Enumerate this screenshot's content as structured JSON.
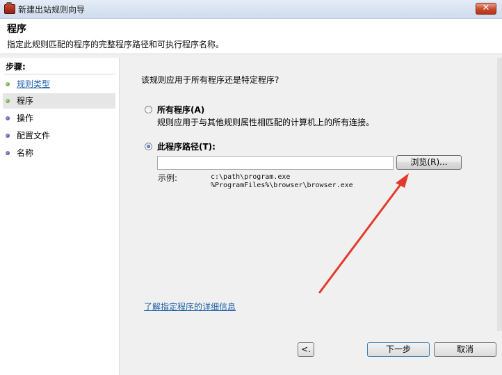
{
  "window": {
    "title": "新建出站规则向导",
    "close_label": "✕"
  },
  "header": {
    "title": "程序",
    "description": "指定此规则匹配的程序的完整程序路径和可执行程序名称。"
  },
  "steps": {
    "heading": "步骤:",
    "items": [
      {
        "label": "规则类型",
        "state": "done"
      },
      {
        "label": "程序",
        "state": "current"
      },
      {
        "label": "操作",
        "state": "pending"
      },
      {
        "label": "配置文件",
        "state": "pending"
      },
      {
        "label": "名称",
        "state": "pending"
      }
    ]
  },
  "main": {
    "question": "该规则应用于所有程序还是特定程序?",
    "option_all": {
      "title": "所有程序(A)",
      "description": "规则应用于与其他规则属性相匹配的计算机上的所有连接。",
      "selected": false
    },
    "option_path": {
      "title": "此程序路径(T):",
      "selected": true
    },
    "path_input": {
      "value": "",
      "placeholder": ""
    },
    "browse_label": "浏览(R)...",
    "example_label": "示例:",
    "example_lines": [
      "c:\\path\\program.exe",
      "%ProgramFiles%\\browser\\browser.exe"
    ],
    "help_link": "了解指定程序的详细信息"
  },
  "footer": {
    "back_label": "<.",
    "next_label": "下一步",
    "cancel_label": "取消"
  },
  "colors": {
    "link": "#1f5fa8",
    "annotation_arrow": "#e23a2a"
  },
  "icons": {
    "window": "firewall-icon",
    "step_done": "green-dot-icon",
    "step_pending": "purple-dot-icon"
  }
}
